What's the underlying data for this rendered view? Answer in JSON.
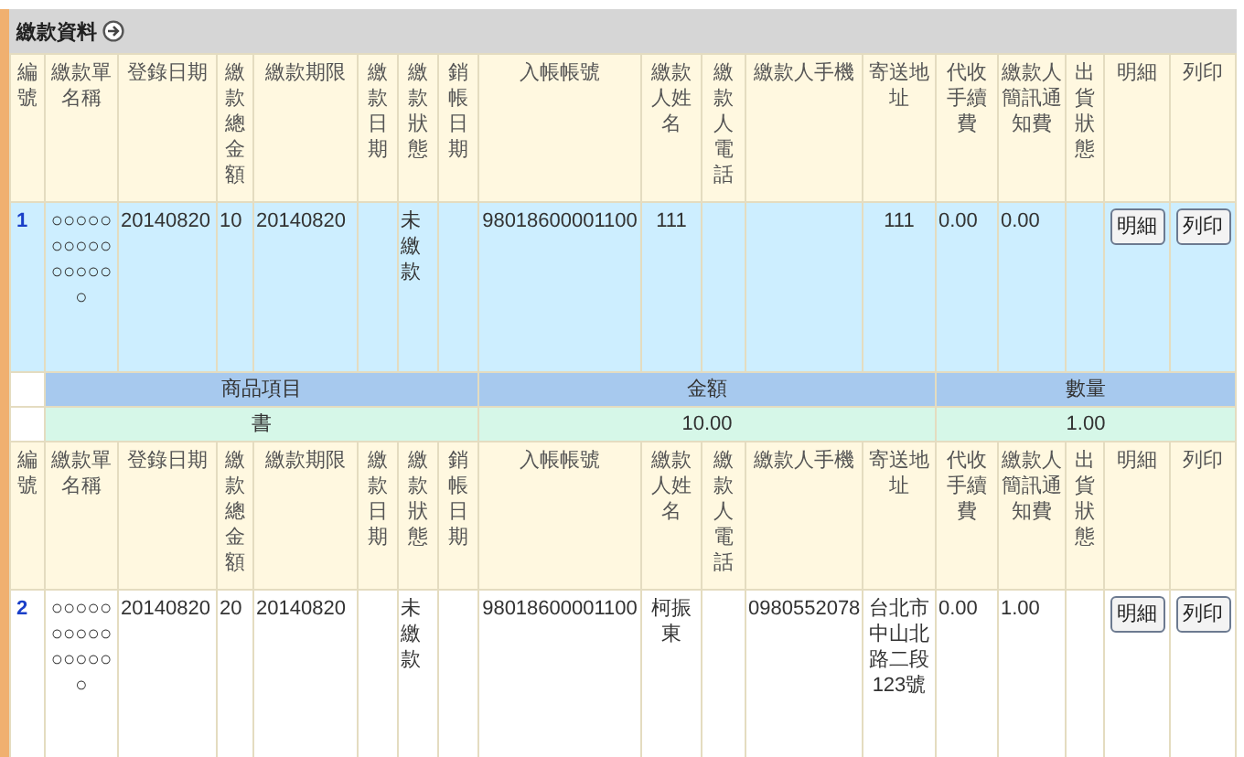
{
  "section": {
    "title": "繳款資料"
  },
  "records": [
    {
      "selected": true,
      "columns": [
        "編號",
        "繳款單名稱",
        "登錄日期",
        "繳款總金額",
        "繳款期限",
        "繳款日期",
        "繳款狀態",
        "銷帳日期",
        "入帳帳號",
        "繳款人姓名",
        "繳款人電話",
        "繳款人手機",
        "寄送地址",
        "代收手續費",
        "繳款人簡訊通知費",
        "出貨狀態",
        "明細",
        "列印"
      ],
      "number": "1",
      "cells": [
        "○○○○○○○○○○○○○○○○",
        "20140820",
        "10",
        "20140820",
        null,
        "未繳款",
        null,
        "98018600001100",
        "111",
        null,
        null,
        "111",
        "0.00",
        "0.00",
        null
      ],
      "detail_button": "明細",
      "print_button": "列印",
      "items": {
        "columns": [
          "商品項目",
          "金額",
          "數量"
        ],
        "rows": [
          [
            "書",
            "10.00",
            "1.00"
          ]
        ]
      }
    },
    {
      "selected": false,
      "columns": [
        "編號",
        "繳款單名稱",
        "登錄日期",
        "繳款總金額",
        "繳款期限",
        "繳款日期",
        "繳款狀態",
        "銷帳日期",
        "入帳帳號",
        "繳款人姓名",
        "繳款人電話",
        "繳款人手機",
        "寄送地址",
        "代收手續費",
        "繳款人簡訊通知費",
        "出貨狀態",
        "明細",
        "列印"
      ],
      "number": "2",
      "cells": [
        "○○○○○○○○○○○○○○○○",
        "20140820",
        "20",
        "20140820",
        null,
        "未繳款",
        null,
        "98018600001100",
        "柯振東",
        null,
        "0980552078",
        "台北市中山北路二段123號",
        "0.00",
        "1.00",
        null
      ],
      "detail_button": "明細",
      "print_button": "列印"
    }
  ]
}
